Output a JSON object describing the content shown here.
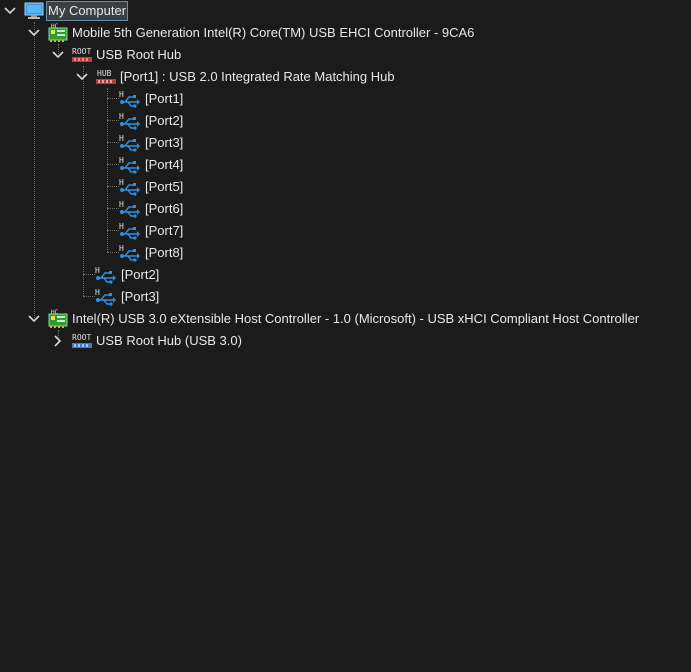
{
  "tree": {
    "root": {
      "label": "My Computer",
      "icon": "computer-icon"
    },
    "ehci_controller": {
      "label": "Mobile 5th Generation Intel(R) Core(TM) USB EHCI Controller - 9CA6",
      "icon": "host-controller-icon"
    },
    "ehci_root_hub": {
      "label": "USB Root Hub",
      "icon": "root-hub-icon",
      "icon_text": "ROOT"
    },
    "port1_hub": {
      "label": "[Port1] : USB 2.0 Integrated Rate Matching Hub",
      "icon": "hub-icon",
      "icon_text": "HUB"
    },
    "hub_ports": [
      {
        "label": "[Port1]"
      },
      {
        "label": "[Port2]"
      },
      {
        "label": "[Port3]"
      },
      {
        "label": "[Port4]"
      },
      {
        "label": "[Port5]"
      },
      {
        "label": "[Port6]"
      },
      {
        "label": "[Port7]"
      },
      {
        "label": "[Port8]"
      }
    ],
    "root_ports": [
      {
        "label": "[Port2]"
      },
      {
        "label": "[Port3]"
      }
    ],
    "xhci_controller": {
      "label": "Intel(R) USB 3.0 eXtensible Host Controller - 1.0 (Microsoft) - USB xHCI Compliant Host Controller",
      "icon": "host-controller-icon"
    },
    "xhci_root_hub": {
      "label": "USB Root Hub (USB 3.0)",
      "icon": "root-hub-icon",
      "icon_text": "ROOT"
    }
  },
  "colors": {
    "background": "#1b1b1b",
    "text": "#e8e8e8",
    "usb_blue": "#2f8fe0",
    "hc_green": "#2e9a3a",
    "root_red": "#c23a3a",
    "root_blue": "#3a7cd0"
  }
}
